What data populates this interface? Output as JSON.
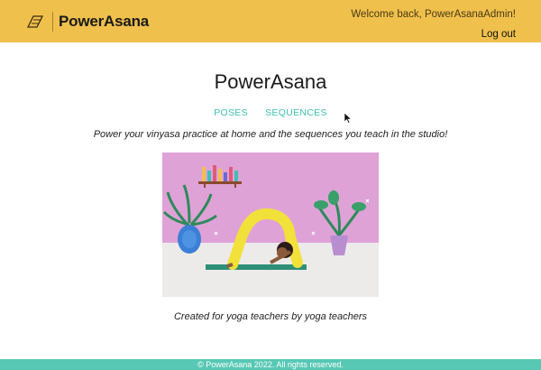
{
  "header": {
    "brand_name": "PowerAsana",
    "welcome_text": "Welcome back, PowerAsanaAdmin!",
    "logout_label": "Log out",
    "background_color": "#f0c04c",
    "logo_icon": "yoga-mat-icon"
  },
  "main": {
    "title": "PowerAsana",
    "nav": {
      "poses_label": "POSES",
      "sequences_label": "SEQUENCES",
      "link_color": "#3fbfb0"
    },
    "tagline": "Power your vinyasa practice at home and the sequences you teach in the studio!",
    "hero_alt": "yoga-illustration",
    "credit": "Created for yoga teachers by yoga teachers"
  },
  "footer": {
    "text": "© PowerAsana 2022. All rights reserved.",
    "background_color": "#57c8b4"
  }
}
